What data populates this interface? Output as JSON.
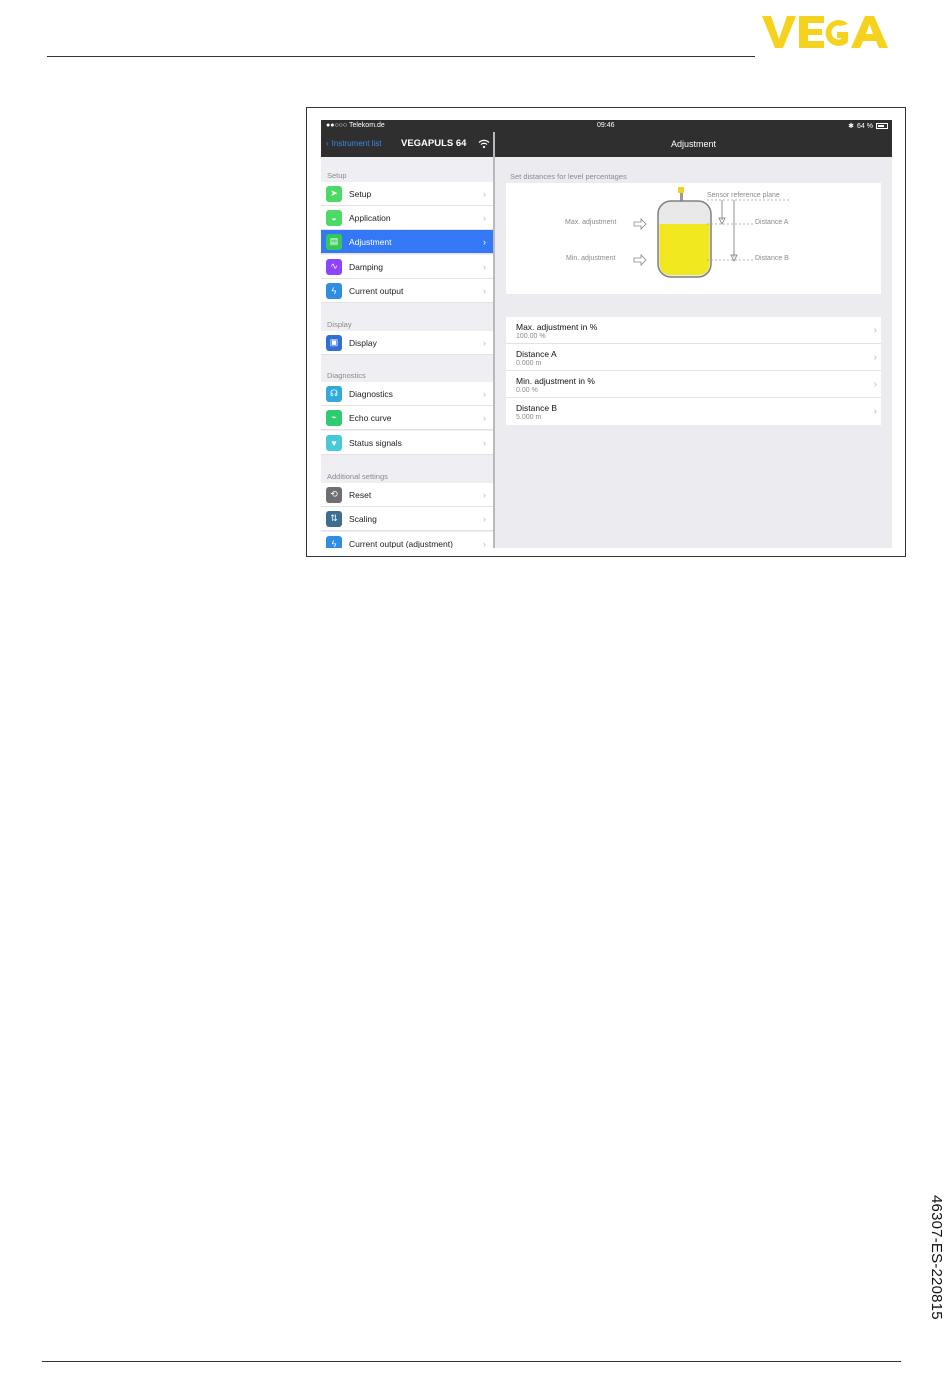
{
  "page": {
    "brand": "VEGA",
    "doc_code": "46307-ES-220815",
    "colors": {
      "brand_yellow": "#f5d21d",
      "accent_blue": "#3478f6",
      "nav_dark": "#2f2f2f",
      "tank_fill": "#f2e820"
    }
  },
  "statusbar": {
    "carrier": "●●○○○ Telekom.de",
    "time": "09:46",
    "battery": "64 %"
  },
  "navbar": {
    "back_label": "Instrument list",
    "device_title": "VEGAPULS 64",
    "detail_title": "Adjustment"
  },
  "sidebar": {
    "sections": [
      {
        "title": "Setup",
        "items": [
          {
            "label": "Setup",
            "icon": "paper-plane-icon",
            "color": "#4cd964"
          },
          {
            "label": "Application",
            "icon": "tank-icon",
            "color": "#4cd964"
          },
          {
            "label": "Adjustment",
            "icon": "adjustment-icon",
            "color": "#34c759",
            "selected": true
          },
          {
            "label": "Damping",
            "icon": "wave-icon",
            "color": "#8e44ff"
          },
          {
            "label": "Current output",
            "icon": "lightning-icon",
            "color": "#2f8ee0"
          }
        ]
      },
      {
        "title": "Display",
        "items": [
          {
            "label": "Display",
            "icon": "display-icon",
            "color": "#2f6fd6"
          }
        ]
      },
      {
        "title": "Diagnostics",
        "items": [
          {
            "label": "Diagnostics",
            "icon": "stethoscope-icon",
            "color": "#34aadc"
          },
          {
            "label": "Echo curve",
            "icon": "echo-curve-icon",
            "color": "#2ecc71"
          },
          {
            "label": "Status signals",
            "icon": "heart-icon",
            "color": "#48c9d8"
          }
        ]
      },
      {
        "title": "Additional settings",
        "items": [
          {
            "label": "Reset",
            "icon": "reset-icon",
            "color": "#6e6e73"
          },
          {
            "label": "Scaling",
            "icon": "scaling-icon",
            "color": "#3c6e8f"
          },
          {
            "label": "Current output (adjustment)",
            "icon": "lightning-icon",
            "color": "#2f8ee0"
          }
        ]
      }
    ]
  },
  "detail": {
    "caption": "Set distances for level percentages",
    "diagram": {
      "sensor_reference": "Sensor reference plane",
      "max_label": "Max. adjustment",
      "min_label": "Min. adjustment",
      "distance_a_label": "Distance A",
      "distance_b_label": "Distance B"
    },
    "params": [
      {
        "name": "Max. adjustment in %",
        "value": "100.00 %"
      },
      {
        "name": "Distance A",
        "value": "0.000 m"
      },
      {
        "name": "Min. adjustment in %",
        "value": "0.00 %"
      },
      {
        "name": "Distance B",
        "value": "5.000 m"
      }
    ]
  }
}
